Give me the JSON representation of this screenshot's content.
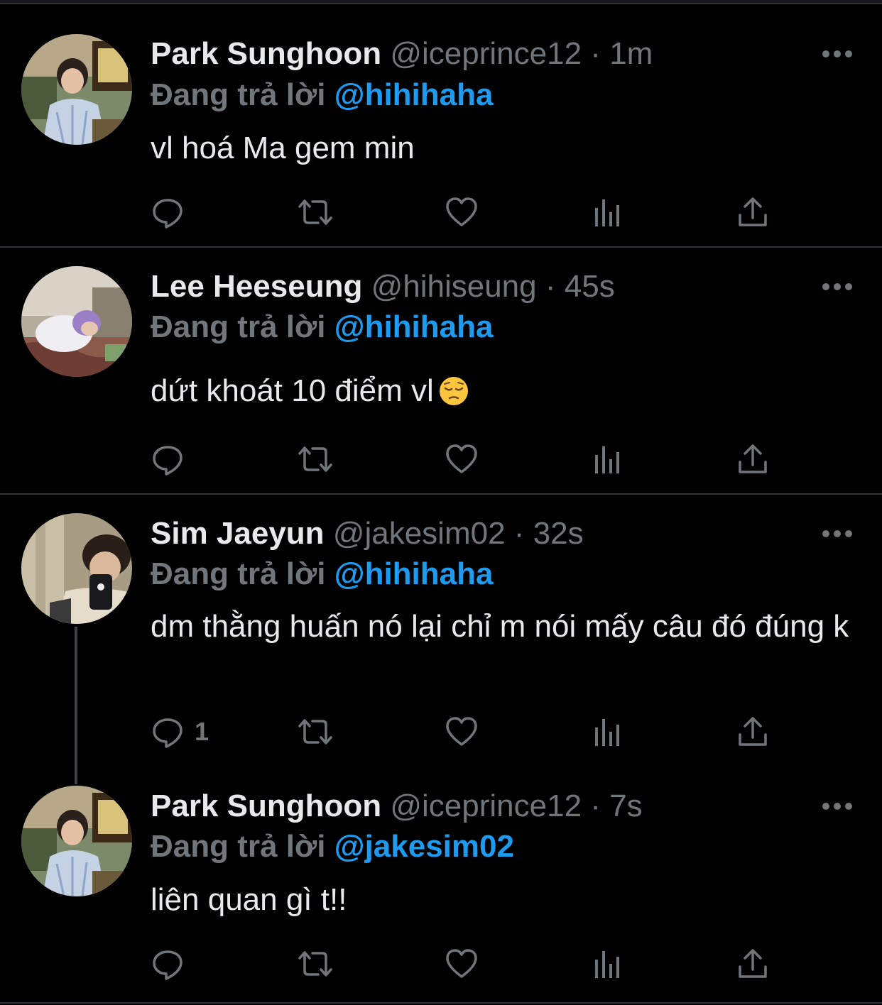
{
  "tweets": [
    {
      "name": "Park Sunghoon",
      "handle": "@iceprince12",
      "separator": "·",
      "time": "1m",
      "reply_prefix": "Đang trả lời",
      "reply_to": "@hihihaha",
      "text": "vl hoá Ma gem min",
      "reply_count": ""
    },
    {
      "name": "Lee Heeseung",
      "handle": "@hihiseung",
      "separator": "·",
      "time": "45s",
      "reply_prefix": "Đang trả lời",
      "reply_to": "@hihihaha",
      "text": "dứt khoát 10 điểm vl",
      "emoji": "pensive-face",
      "reply_count": ""
    },
    {
      "name": "Sim Jaeyun",
      "handle": "@jakesim02",
      "separator": "·",
      "time": "32s",
      "reply_prefix": "Đang trả lời",
      "reply_to": "@hihihaha",
      "text": "dm thằng huấn nó lại chỉ m nói mấy câu đó đúng k",
      "reply_count": "1"
    },
    {
      "name": "Park Sunghoon",
      "handle": "@iceprince12",
      "separator": "·",
      "time": "7s",
      "reply_prefix": "Đang trả lời",
      "reply_to": "@jakesim02",
      "text": "liên quan gì t!!",
      "reply_count": ""
    }
  ],
  "icons": {
    "reply": "reply-icon",
    "retweet": "retweet-icon",
    "like": "like-icon",
    "analytics": "analytics-icon",
    "share": "share-icon",
    "more": "more-icon"
  },
  "colors": {
    "background": "#000000",
    "text": "#e7e9ea",
    "muted": "#71767b",
    "mention": "#1d9bf0",
    "divider": "#2f3336"
  }
}
